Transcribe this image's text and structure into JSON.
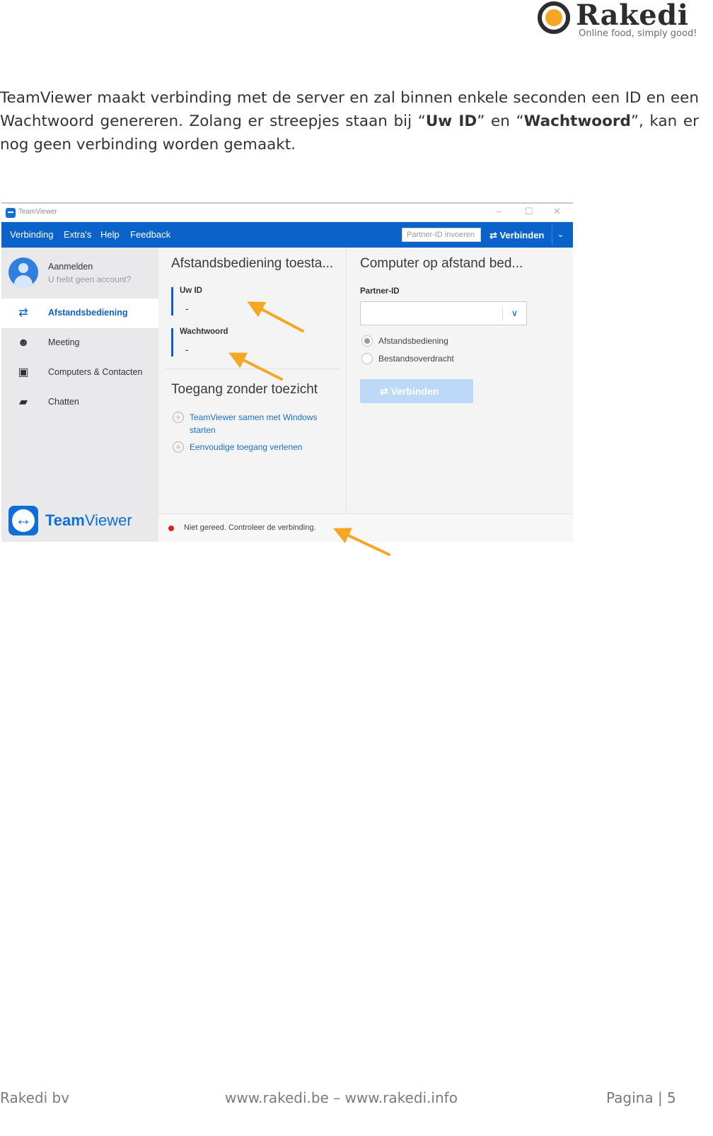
{
  "brand": {
    "name": "Rakedi",
    "tagline": "Online food, simply good!"
  },
  "intro": {
    "part1": "TeamViewer maakt verbinding met de server en zal binnen enkele seconden een ID en een Wachtwoord genereren. Zolang er streepjes staan bij “",
    "bold1": "Uw ID",
    "part2": "” en “",
    "bold2": "Wachtwoord",
    "part3": "”, kan er nog geen verbinding worden gemaakt."
  },
  "teamviewer": {
    "window_title": "TeamViewer",
    "window_controls": [
      "–",
      "☐",
      "✕"
    ],
    "menu": [
      "Verbinding",
      "Extra's",
      "Help",
      "Feedback"
    ],
    "partner_placeholder": "Partner-ID invoeren",
    "connect_label": "Verbinden",
    "sidebar": {
      "login": "Aanmelden",
      "login_sub": "U hebt geen account?",
      "items": [
        {
          "label": "Afstandsbediening",
          "icon": "arrows-icon",
          "active": true
        },
        {
          "label": "Meeting",
          "icon": "meeting-icon",
          "active": false
        },
        {
          "label": "Computers & Contacten",
          "icon": "contacts-icon",
          "active": false
        },
        {
          "label": "Chatten",
          "icon": "chat-icon",
          "active": false
        }
      ],
      "logo_bold": "Team",
      "logo_rest": "Viewer"
    },
    "remote": {
      "heading": "Afstandsbediening toesta...",
      "id_label": "Uw ID",
      "id_value": "-",
      "pw_label": "Wachtwoord",
      "pw_value": "-",
      "unattended_heading": "Toegang zonder toezicht",
      "link1": "TeamViewer samen met Windows starten",
      "link2": "Eenvoudige toegang verlenen"
    },
    "control": {
      "heading": "Computer op afstand bed...",
      "partner_label": "Partner-ID",
      "option1": "Afstandsbediening",
      "option2": "Bestandsoverdracht",
      "connect_button": "Verbinden"
    },
    "status": {
      "text": "Niet gereed. Controleer de verbinding.",
      "color": "#e02020"
    },
    "colors": {
      "primary": "#0b62c9",
      "arrow": "#f5a623"
    }
  },
  "footer": {
    "company": "Rakedi bv",
    "websites": "www.rakedi.be – www.rakedi.info",
    "page": "Pagina | 5"
  }
}
